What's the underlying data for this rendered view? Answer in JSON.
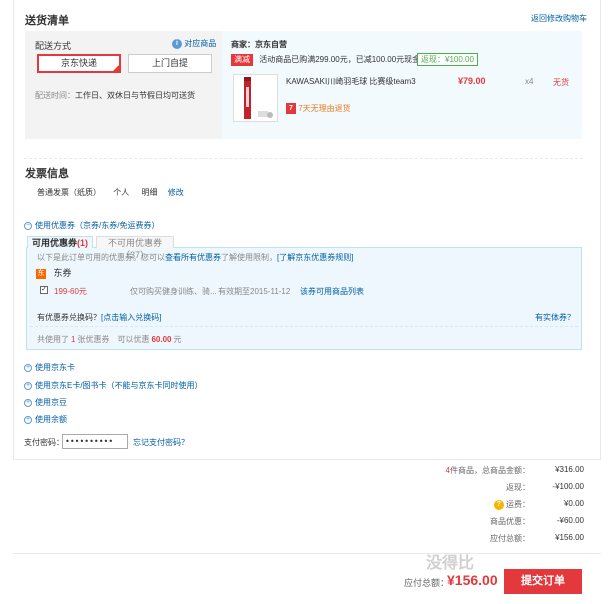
{
  "shipping": {
    "title": "送货清单",
    "back_link": "返回修改购物车",
    "method_label": "配送方式",
    "match_link": "对应商品",
    "options": [
      "京东快递",
      "上门自提"
    ],
    "delivery_time_label": "配送时间：",
    "delivery_time_value": "工作日、双休日与节假日均可送货"
  },
  "seller": {
    "label": "商家：京东自营",
    "promo_tag": "满减",
    "promo_text": "活动商品已购满299.00元，已减100.00元现金",
    "discount_tag": "返现：¥100.00",
    "product_name": "KAWASAKI川崎羽毛球 比赛级team3",
    "price": "¥79.00",
    "qty": "x4",
    "stock": "无货",
    "return_badge": "7",
    "return_text": "7天无理由退货"
  },
  "invoice": {
    "title": "发票信息",
    "type": "普通发票（纸质）",
    "payer": "个人",
    "content": "明细",
    "edit": "修改"
  },
  "coupon": {
    "toggle": "使用优惠券（京券/东券/免运费券）",
    "tab_available": "可用优惠券",
    "tab_available_count": "(1)",
    "tab_unavailable": "不可用优惠券（37）",
    "note_prefix": "以下是此订单可用的优惠券。您可以",
    "note_link1": "查看所有优惠券",
    "note_mid": "了解使用限制，",
    "note_link2": "[了解京东优惠券规则]",
    "group_icon": "东",
    "group_name": "东券",
    "item_amount": "199-60元",
    "item_desc": "仅可购买健身训练、骑...",
    "item_expire": "有效期至2015-11-12",
    "item_link": "该券可用商品列表",
    "redeem_prefix": "有优惠券兑换码？",
    "redeem_link": "[点击输入兑换码]",
    "physical_link": "有实体券？",
    "summary_prefix": "共使用了",
    "summary_count": "1",
    "summary_mid": "张优惠券　可以优惠",
    "summary_amount": "60.00",
    "summary_suffix": "元"
  },
  "extras": [
    "使用京东卡",
    "使用京东E卡/图书卡（不能与京东卡同时使用）",
    "使用京豆",
    "使用余额"
  ],
  "payment": {
    "password_label": "支付密码：",
    "password_value": "••••••••••",
    "forgot_link": "忘记支付密码？"
  },
  "summary": {
    "items_count": "4",
    "items_label": "件商品，总商品金额：",
    "items_total": "¥316.00",
    "cashback_label": "返现：",
    "cashback_value": "-¥100.00",
    "freight_label": "运费：",
    "freight_value": "¥0.00",
    "discount_label": "商品优惠：",
    "discount_value": "-¥60.00",
    "payable_label": "应付总额：",
    "payable_value": "¥156.00"
  },
  "footer": {
    "total_label": "应付总额：",
    "total_value": "¥156.00",
    "submit": "提交订单",
    "watermark": "没得比"
  },
  "colors": {
    "accent": "#e4393c",
    "link": "#005ea7",
    "green": "#4cae4c"
  }
}
